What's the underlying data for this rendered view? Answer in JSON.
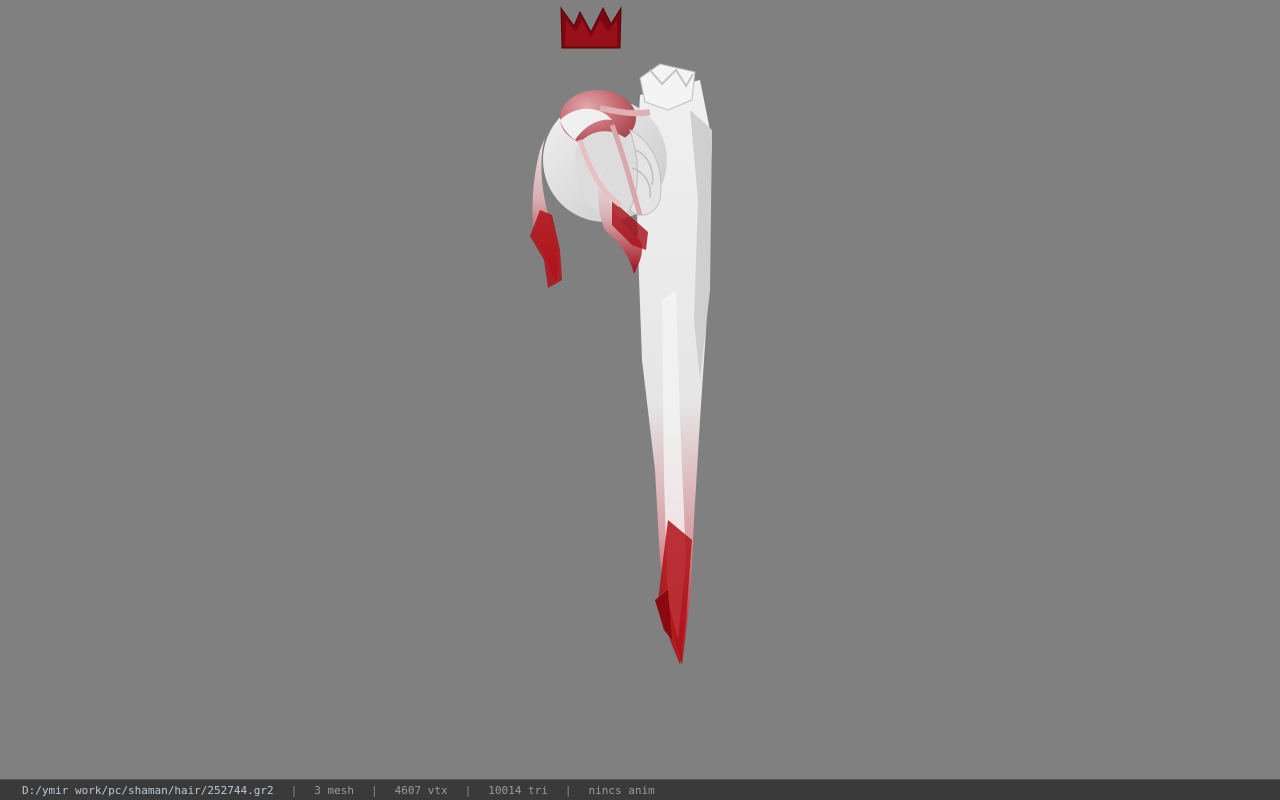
{
  "viewport": {
    "background_color": "#808080",
    "model_icons": [
      "crown-icon",
      "hair-model"
    ],
    "colors": {
      "crown": "#8a0a12",
      "hair_white": "#e9e9e9",
      "hair_red": "#b01018"
    }
  },
  "statusbar": {
    "file_path": "D:/ymir work/pc/shaman/hair/252744.gr2",
    "separator": "|",
    "mesh_count": "3 mesh",
    "vertex_count": "4607 vtx",
    "triangle_count": "10014 tri",
    "anim": "nincs anim"
  }
}
